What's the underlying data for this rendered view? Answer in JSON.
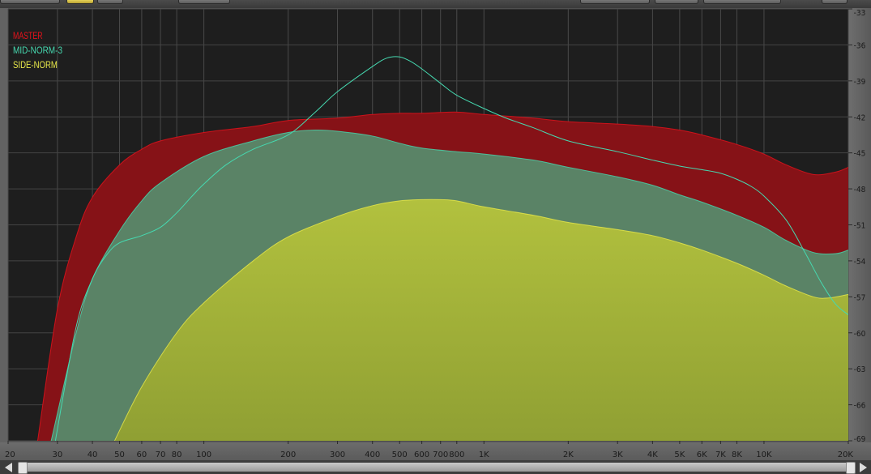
{
  "chart_data": {
    "type": "area",
    "x_scale": "log",
    "xlim": [
      20,
      20000
    ],
    "ylim": [
      -69,
      -33
    ],
    "grid": true,
    "legend_placement": "top-left",
    "x_ticks": [
      {
        "value": 20,
        "label": "20"
      },
      {
        "value": 30,
        "label": "30"
      },
      {
        "value": 40,
        "label": "40"
      },
      {
        "value": 50,
        "label": "50"
      },
      {
        "value": 60,
        "label": "60"
      },
      {
        "value": 70,
        "label": "70"
      },
      {
        "value": 80,
        "label": "80"
      },
      {
        "value": 100,
        "label": "100"
      },
      {
        "value": 200,
        "label": "200"
      },
      {
        "value": 300,
        "label": "300"
      },
      {
        "value": 400,
        "label": "400"
      },
      {
        "value": 500,
        "label": "500"
      },
      {
        "value": 600,
        "label": "600"
      },
      {
        "value": 700,
        "label": "700"
      },
      {
        "value": 800,
        "label": "800"
      },
      {
        "value": 1000,
        "label": "1K"
      },
      {
        "value": 2000,
        "label": "2K"
      },
      {
        "value": 3000,
        "label": "3K"
      },
      {
        "value": 4000,
        "label": "4K"
      },
      {
        "value": 5000,
        "label": "5K"
      },
      {
        "value": 6000,
        "label": "6K"
      },
      {
        "value": 7000,
        "label": "7K"
      },
      {
        "value": 8000,
        "label": "8K"
      },
      {
        "value": 10000,
        "label": "10K"
      },
      {
        "value": 20000,
        "label": "20K"
      }
    ],
    "y_ticks": [
      -33,
      -36,
      -39,
      -42,
      -45,
      -48,
      -51,
      -54,
      -57,
      -60,
      -63,
      -66,
      -69
    ],
    "series": [
      {
        "name": "MASTER",
        "color": "#e8121b",
        "fill": "#861217",
        "style": "fill",
        "points": [
          [
            25.5,
            -69
          ],
          [
            30,
            -58
          ],
          [
            35,
            -52
          ],
          [
            40,
            -48.7
          ],
          [
            50,
            -46
          ],
          [
            60,
            -44.7
          ],
          [
            70,
            -44
          ],
          [
            100,
            -43.3
          ],
          [
            150,
            -42.8
          ],
          [
            200,
            -42.3
          ],
          [
            300,
            -42.1
          ],
          [
            400,
            -41.8
          ],
          [
            500,
            -41.7
          ],
          [
            600,
            -41.7
          ],
          [
            800,
            -41.6
          ],
          [
            1000,
            -41.8
          ],
          [
            1500,
            -42.1
          ],
          [
            2000,
            -42.4
          ],
          [
            3000,
            -42.6
          ],
          [
            4000,
            -42.8
          ],
          [
            5000,
            -43.1
          ],
          [
            6000,
            -43.5
          ],
          [
            8000,
            -44.3
          ],
          [
            10000,
            -45.1
          ],
          [
            12000,
            -46
          ],
          [
            15000,
            -46.8
          ],
          [
            18000,
            -46.6
          ],
          [
            20000,
            -46.2
          ]
        ]
      },
      {
        "name": "MID-NORM-3",
        "color": "#46d9b0",
        "fill": "#5a8366",
        "style": "fill",
        "points": [
          [
            28.5,
            -69
          ],
          [
            35,
            -60
          ],
          [
            40,
            -55.5
          ],
          [
            50,
            -51.5
          ],
          [
            60,
            -49
          ],
          [
            70,
            -47.5
          ],
          [
            100,
            -45.3
          ],
          [
            150,
            -44
          ],
          [
            200,
            -43.3
          ],
          [
            250,
            -43.1
          ],
          [
            300,
            -43.2
          ],
          [
            400,
            -43.6
          ],
          [
            500,
            -44.2
          ],
          [
            600,
            -44.6
          ],
          [
            800,
            -44.9
          ],
          [
            1000,
            -45.1
          ],
          [
            1500,
            -45.6
          ],
          [
            2000,
            -46.2
          ],
          [
            3000,
            -47
          ],
          [
            4000,
            -47.7
          ],
          [
            5000,
            -48.5
          ],
          [
            6000,
            -49.1
          ],
          [
            8000,
            -50.2
          ],
          [
            10000,
            -51.2
          ],
          [
            12000,
            -52.3
          ],
          [
            15000,
            -53.3
          ],
          [
            18000,
            -53.4
          ],
          [
            20000,
            -53.1
          ]
        ]
      },
      {
        "name": "SIDE-NORM",
        "color": "#e8e84a",
        "fill": "#a4b43c",
        "style": "fill",
        "points": [
          [
            48,
            -69
          ],
          [
            60,
            -64.5
          ],
          [
            80,
            -60
          ],
          [
            100,
            -57.5
          ],
          [
            150,
            -54
          ],
          [
            200,
            -52
          ],
          [
            300,
            -50.3
          ],
          [
            400,
            -49.4
          ],
          [
            500,
            -49
          ],
          [
            600,
            -48.9
          ],
          [
            700,
            -48.9
          ],
          [
            800,
            -49
          ],
          [
            1000,
            -49.5
          ],
          [
            1500,
            -50.2
          ],
          [
            2000,
            -50.8
          ],
          [
            3000,
            -51.4
          ],
          [
            4000,
            -51.9
          ],
          [
            5000,
            -52.5
          ],
          [
            6000,
            -53.1
          ],
          [
            8000,
            -54.2
          ],
          [
            10000,
            -55.2
          ],
          [
            12000,
            -56.1
          ],
          [
            15000,
            -57
          ],
          [
            17000,
            -57.1
          ],
          [
            20000,
            -56.8
          ]
        ]
      },
      {
        "name": "MID-NORM-3 (peak trace)",
        "color": "#46d9b0",
        "style": "line",
        "points": [
          [
            29.5,
            -69
          ],
          [
            35,
            -59.5
          ],
          [
            40,
            -55.5
          ],
          [
            45,
            -53.5
          ],
          [
            50,
            -52.5
          ],
          [
            60,
            -51.9
          ],
          [
            70,
            -51.2
          ],
          [
            80,
            -50
          ],
          [
            90,
            -48.7
          ],
          [
            100,
            -47.6
          ],
          [
            120,
            -46
          ],
          [
            150,
            -44.7
          ],
          [
            200,
            -43.5
          ],
          [
            250,
            -41.6
          ],
          [
            300,
            -39.9
          ],
          [
            400,
            -37.8
          ],
          [
            450,
            -37.1
          ],
          [
            500,
            -37
          ],
          [
            550,
            -37.4
          ],
          [
            600,
            -38
          ],
          [
            700,
            -39.2
          ],
          [
            800,
            -40.2
          ],
          [
            1000,
            -41.3
          ],
          [
            1200,
            -42.1
          ],
          [
            1500,
            -42.9
          ],
          [
            2000,
            -44
          ],
          [
            3000,
            -44.9
          ],
          [
            4000,
            -45.6
          ],
          [
            5000,
            -46.1
          ],
          [
            6000,
            -46.4
          ],
          [
            7000,
            -46.7
          ],
          [
            8000,
            -47.2
          ],
          [
            9000,
            -47.8
          ],
          [
            10000,
            -48.6
          ],
          [
            12000,
            -50.6
          ],
          [
            14000,
            -53.3
          ],
          [
            16000,
            -55.8
          ],
          [
            18000,
            -57.6
          ],
          [
            20000,
            -58.5
          ]
        ]
      }
    ]
  }
}
